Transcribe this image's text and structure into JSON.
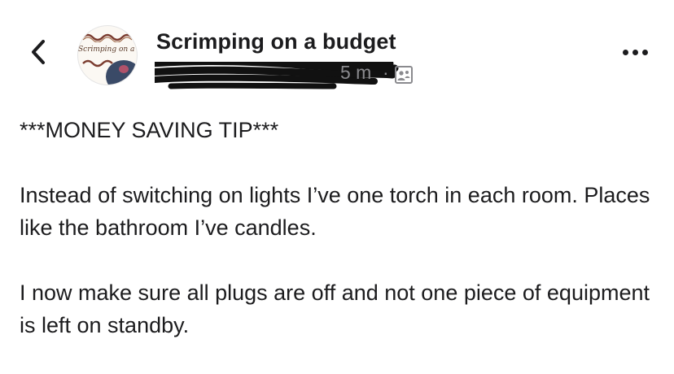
{
  "header": {
    "back_icon": "chevron-left-icon",
    "avatar_text": "Scrimping on a Budg",
    "group_name": "Scrimping on a budget",
    "timestamp": "5 m",
    "separator": "·",
    "visibility_icon": "members-icon",
    "more_icon": "more-horizontal-icon"
  },
  "post": {
    "tip_heading": "***MONEY SAVING TIP***",
    "paragraph_1": "Instead of switching on lights I’ve one torch in each room. Places like the bathroom I’ve candles.",
    "paragraph_2": "I now make sure all plugs are off and not one piece of equipment is left on standby."
  },
  "colors": {
    "text": "#1c1c1e",
    "meta": "#8a8a8e",
    "redaction": "#111111"
  }
}
